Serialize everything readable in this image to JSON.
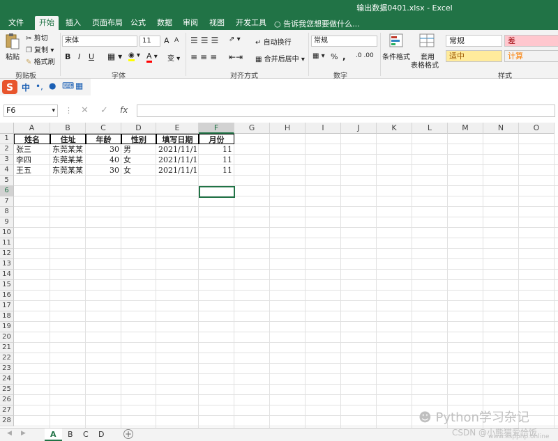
{
  "window": {
    "title": "输出数据0401.xlsx  -  Excel"
  },
  "ribbon_tabs": [
    "文件",
    "开始",
    "插入",
    "页面布局",
    "公式",
    "数据",
    "审阅",
    "视图",
    "开发工具"
  ],
  "active_tab": "开始",
  "tell_me": "告诉我您想要做什么...",
  "clipboard": {
    "paste": "粘贴",
    "cut": "剪切",
    "copy": "复制",
    "format_painter": "格式刷",
    "label": "剪贴板"
  },
  "font": {
    "name": "宋体",
    "size": "11",
    "bold": "B",
    "italic": "I",
    "underline": "U",
    "label": "字体",
    "grow": "A",
    "shrink": "A",
    "font_color": "A",
    "phonetic": "变"
  },
  "alignment": {
    "wrap": "自动换行",
    "merge": "合并后居中",
    "label": "对齐方式"
  },
  "number": {
    "format": "常规",
    "percent": "%",
    "comma": ",",
    "label": "数字"
  },
  "styles": {
    "conditional": "条件格式",
    "table_line1": "套用",
    "table_line2": "表格格式",
    "label": "样式",
    "cells": [
      {
        "text": "常规",
        "bg": "#ffffff",
        "color": "#222222"
      },
      {
        "text": "差",
        "bg": "#ffc7ce",
        "color": "#9c0006"
      },
      {
        "text": "适中",
        "bg": "#ffeb9c",
        "color": "#9c5700"
      },
      {
        "text": "计算",
        "bg": "#f2f2f2",
        "color": "#fa7d00"
      }
    ]
  },
  "ime": {
    "mode": "中"
  },
  "formula_bar": {
    "name_box": "F6",
    "fx": "fx",
    "value": ""
  },
  "columns": [
    "A",
    "B",
    "C",
    "D",
    "E",
    "F",
    "G",
    "H",
    "I",
    "J",
    "K",
    "L",
    "M",
    "N",
    "O"
  ],
  "rows": [
    "1",
    "2",
    "3",
    "4",
    "5",
    "6",
    "7",
    "8",
    "9",
    "10",
    "11",
    "12",
    "13",
    "14",
    "15",
    "16",
    "17",
    "18",
    "19",
    "20",
    "21",
    "22",
    "23",
    "24",
    "25",
    "26",
    "27",
    "28"
  ],
  "sheet": {
    "headers": [
      "姓名",
      "住址",
      "年龄",
      "性别",
      "填写日期",
      "月份"
    ],
    "data": [
      [
        "张三",
        "东莞某某",
        "30",
        "男",
        "2021/11/1",
        "11"
      ],
      [
        "李四",
        "东莞某某",
        "40",
        "女",
        "2021/11/1",
        "11"
      ],
      [
        "王五",
        "东莞某某",
        "30",
        "女",
        "2021/11/1",
        "11"
      ]
    ]
  },
  "sheet_tabs": [
    "A",
    "B",
    "C",
    "D"
  ],
  "active_sheet": "A",
  "watermark": {
    "main": "Python学习杂记",
    "sub": "CSDN @小熊猫爱恰饭",
    "site": "www.aspphp.online"
  },
  "colors": {
    "accent": "#217346"
  }
}
